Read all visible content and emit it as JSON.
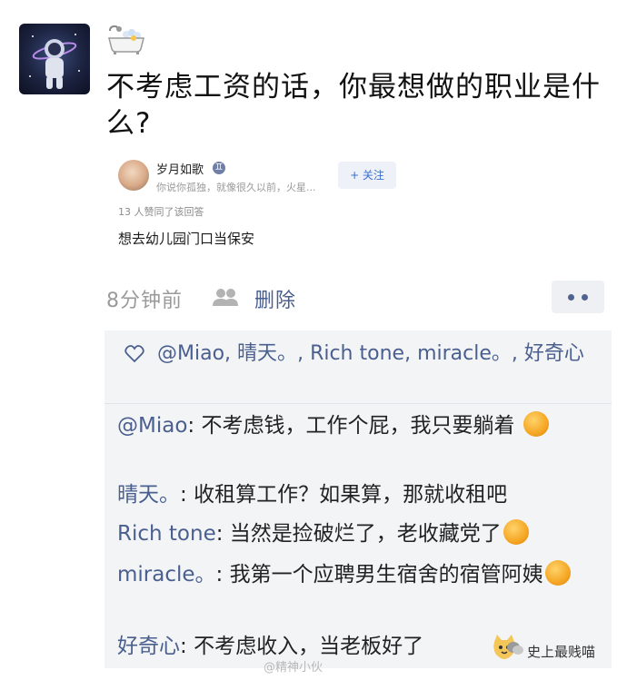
{
  "post": {
    "text": "不考虑工资的话，你最想做的职业是什么?"
  },
  "card": {
    "name": "岁月如歌",
    "badge": "♊",
    "bio": "你说你孤独，就像很久以前，火星...",
    "follow_label": "+ 关注",
    "agree_text": "13 人赞同了该回答",
    "answer": "想去幼儿园门口当保安"
  },
  "meta": {
    "time": "8分钟前",
    "delete_label": "删除"
  },
  "likes": {
    "users": [
      "@Miao",
      "晴天。",
      "Rich tone",
      "miracle。",
      "好奇心"
    ]
  },
  "comments": [
    {
      "author": "@Miao",
      "text": "不考虑钱，工作个屁，我只要躺着"
    },
    {
      "author": "晴天。",
      "text": "收租算工作？如果算，那就收租吧"
    },
    {
      "author": "Rich tone",
      "text": "当然是捡破烂了，老收藏党了"
    },
    {
      "author": "miracle。",
      "text": "我第一个应聘男生宿舍的宿管阿姨"
    },
    {
      "author": "好奇心",
      "text": "不考虑收入，当老板好了"
    }
  ],
  "watermarks": {
    "left": "@精神小伙",
    "right": "史上最贱喵"
  },
  "icons": {
    "avatar": "astronaut-avatar",
    "bath": "bathtub-icon",
    "people": "people-icon",
    "more": "more-dots-icon",
    "heart": "heart-icon"
  }
}
